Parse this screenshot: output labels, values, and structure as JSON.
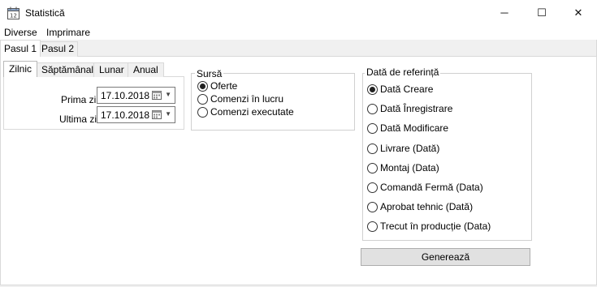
{
  "window": {
    "title": "Statistică",
    "minimize": "─",
    "maximize": "☐",
    "close": "✕"
  },
  "menu": [
    "Diverse",
    "Imprimare"
  ],
  "outer_tabs": [
    "Pasul 1",
    "Pasul 2"
  ],
  "inner_tabs": [
    "Zilnic",
    "Săptămânal",
    "Lunar",
    "Anual"
  ],
  "dates": {
    "first_label": "Prima zi",
    "first_value": "17.10.2018",
    "last_label": "Ultima zi",
    "last_value": "17.10.2018"
  },
  "source": {
    "title": "Sursă",
    "options": [
      "Oferte",
      "Comenzi în lucru",
      "Comenzi executate"
    ],
    "selected_index": 0
  },
  "reference": {
    "title": "Dată de referință",
    "options": [
      "Dată Creare",
      "Dată Înregistrare",
      "Dată Modificare",
      "Livrare (Dată)",
      "Montaj (Data)",
      "Comandă Fermă (Data)",
      "Aprobat tehnic (Dată)",
      "Trecut în producție (Data)"
    ],
    "selected_index": 0
  },
  "generate_button": "Generează"
}
